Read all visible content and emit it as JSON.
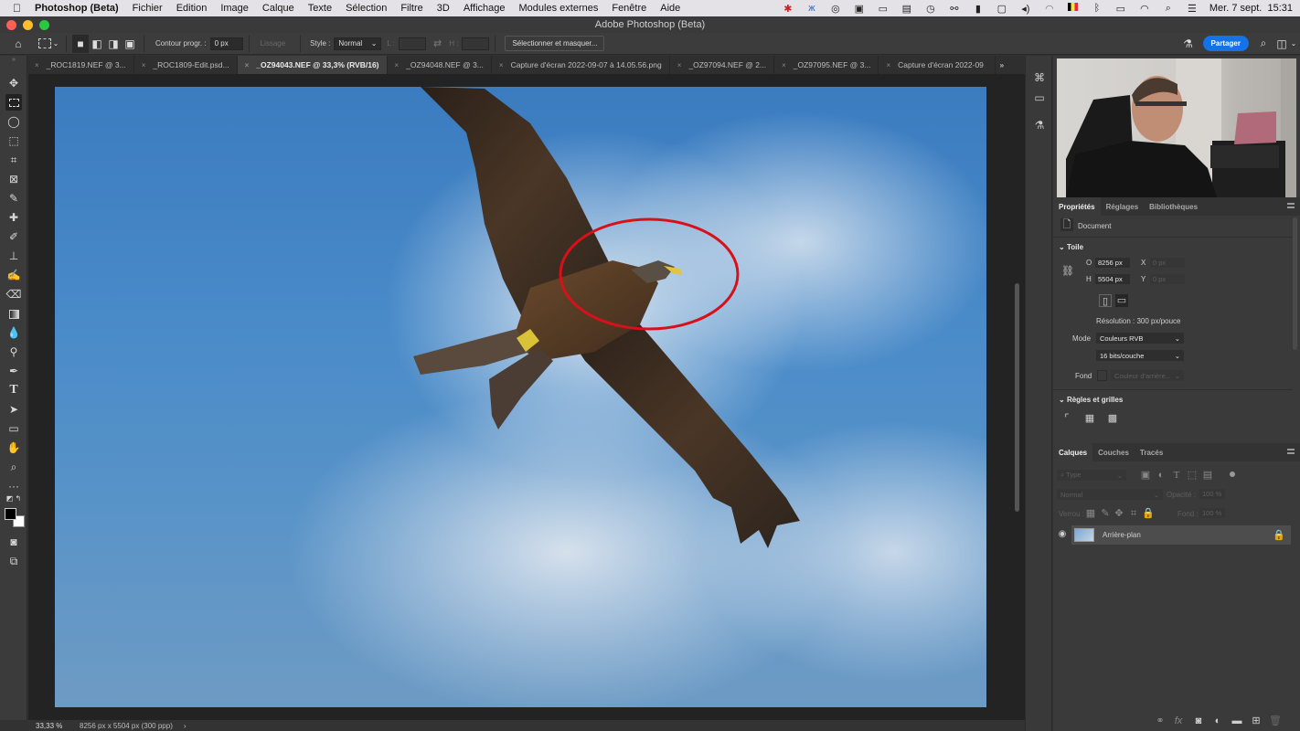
{
  "menubar": {
    "app": "Photoshop (Beta)",
    "items": [
      "Fichier",
      "Edition",
      "Image",
      "Calque",
      "Texte",
      "Sélection",
      "Filtre",
      "3D",
      "Affichage",
      "Modules externes",
      "Fenêtre",
      "Aide"
    ],
    "status_icons": [
      "dropbox-icon",
      "butterfly-icon",
      "creative-cloud-icon",
      "camera-icon",
      "screen-icon",
      "clipboard-icon",
      "time-machine-icon",
      "binoculars-icon",
      "panel-icon",
      "display-icon",
      "volume-icon",
      "airdrop-icon",
      "belgium-flag-icon",
      "bluetooth-icon",
      "battery-icon",
      "wifi-icon",
      "spotlight-icon",
      "control-center-icon"
    ],
    "datetime": "Mer. 7 sept.  15:31"
  },
  "window": {
    "title": "Adobe Photoshop (Beta)"
  },
  "options": {
    "feather_label": "Contour progr. :",
    "feather_value": "0 px",
    "antialias_label": "Lissage",
    "style_label": "Style :",
    "style_value": "Normal",
    "width_label": "L :",
    "height_label": "H :",
    "select_mask_button": "Sélectionner et masquer...",
    "share_button": "Partager"
  },
  "tabs": [
    {
      "label": "_ROC1819.NEF @ 3...",
      "active": false
    },
    {
      "label": "_ROC1809-Edit.psd...",
      "active": false
    },
    {
      "label": "_OZ94043.NEF @ 33,3% (RVB/16)",
      "active": true
    },
    {
      "label": "_OZ94048.NEF @ 3...",
      "active": false
    },
    {
      "label": "Capture d'écran 2022-09-07 à 14.05.56.png",
      "active": false
    },
    {
      "label": "_OZ97094.NEF @ 2...",
      "active": false
    },
    {
      "label": "_OZ97095.NEF @ 3...",
      "active": false
    },
    {
      "label": "Capture d'écran 2022-09",
      "active": false
    }
  ],
  "tabs_overflow": "»",
  "status": {
    "zoom": "33,33 %",
    "doc_info": "8256 px x 5504 px (300 ppp)",
    "arrow": "›"
  },
  "properties": {
    "tabs": [
      "Propriétés",
      "Réglages",
      "Bibliothèques"
    ],
    "doc_label": "Document",
    "canvas_header": "Toile",
    "w_label": "O",
    "w_value": "8256 px",
    "h_label": "H",
    "h_value": "5504 px",
    "x_label": "X",
    "x_value": "0 px",
    "y_label": "Y",
    "y_value": "0 px",
    "resolution": "Résolution : 300 px/pouce",
    "mode_label": "Mode",
    "mode_value": "Couleurs RVB",
    "depth_value": "16 bits/couche",
    "fill_label": "Fond",
    "fill_value": "Couleur d'arrière...",
    "rulers_header": "Règles et grilles"
  },
  "layers": {
    "tabs": [
      "Calques",
      "Couches",
      "Tracés"
    ],
    "filter_placeholder": "Type",
    "blend_mode": "Normal",
    "opacity_label": "Opacité :",
    "opacity_value": "100 %",
    "lock_label": "Verrou :",
    "fill_label": "Fond :",
    "fill_value": "100 %",
    "items": [
      {
        "name": "Arrière-plan",
        "visible": true,
        "locked": true
      }
    ]
  },
  "colors": {
    "accent": "#1473e6",
    "annotation": "#d8101a"
  }
}
